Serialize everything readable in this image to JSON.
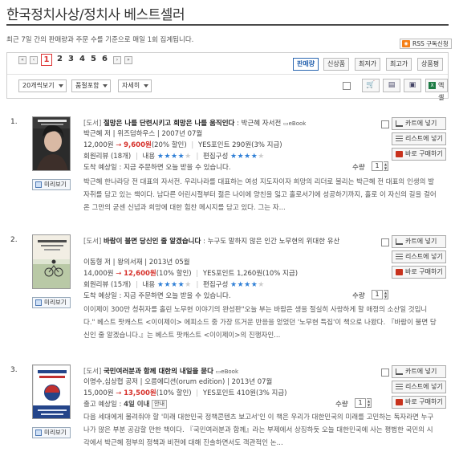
{
  "header": {
    "title": "한국정치사상/정치사 베스트셀러",
    "subtitle": "최근 7일 간의 판매량과 주문 수를 기준으로 매일 1회 집계됩니다.",
    "rss_label": "RSS 구독신청"
  },
  "toolbar": {
    "pager": {
      "first": "«",
      "prev": "‹",
      "next": "›",
      "last": "»",
      "pages": [
        "1",
        "2",
        "3",
        "4",
        "5",
        "6"
      ],
      "current": "1"
    },
    "sort_tabs": [
      "판매량",
      "신상품",
      "최저가",
      "최고가",
      "상품평"
    ],
    "active_sort": "판매량",
    "view_count": "20개씩보기",
    "filter": "품절포함",
    "detail": "자세히",
    "excel_label": "엑셀"
  },
  "books": [
    {
      "rank": "1.",
      "category": "[도서]",
      "title": "절망은 나를 단련시키고 희망은 나를 움직인다",
      "subtitle": ": 박근혜 자서전",
      "ebook": "eBook",
      "meta": "박근혜 저 | 위즈덤하우스 | 2007년 07월",
      "price_original": "12,000원",
      "price_sale": "9,600원",
      "discount": "(20% 할인)",
      "points": "YES포인트 290원(3% 지급)",
      "reviews": "회원리뷰 (18개)",
      "content_label": "내용",
      "content_stars": 4,
      "compose_label": "편집구성",
      "compose_stars": 4,
      "delivery": "도착 예상일 : 지금 주문하면 오늘 받을 수 있습니다.",
      "description": "박근혜 한나라당 전 대표의 자서전. 우리나라를 대표하는 여성 지도자이자 희망의 리더로 불리는 박근혜 전 대표의 인생의 발자취를 담고 있는 책이다. 남다른 어린시절부터 젊은 나이에 양친을 잃고 홀로서기에 성공하기까지, 홀로 이 자신의 길을 걸어온 그만의 굳센 신념과 희망에 대한 힘찬 메시지를 담고 있다. 그는 자..."
    },
    {
      "rank": "2.",
      "category": "[도서]",
      "title": "바람이 불면 당신인 줄 알겠습니다",
      "subtitle": ": 누구도 말하지 않은 인간 노무현의 위대한 유산",
      "ebook": "eBook",
      "meta": "이동형 저 | 왕의서재 | 2013년 05월",
      "price_original": "14,000원",
      "price_sale": "12,600원",
      "discount": "(10% 할인)",
      "points": "YES포인트 1,260원(10% 지급)",
      "reviews": "회원리뷰 (15개)",
      "content_label": "내용",
      "content_stars": 4,
      "compose_label": "편집구성",
      "compose_stars": 4,
      "delivery": "도착 예상일 : 지금 주문하면 오늘 받을 수 있습니다.",
      "description": "이이제이 300만 청취자를 홀린 노무현 이야기의 완성판\"오늘 부는 바람은 생을 절실히 사랑하게 할 애정의 소산일 것입니다.\" 베스트 팟캐스트 <이이제이> 에피소드 중 가장 뜨거운 반응을 얻었던 '노무현 특집'이 책으로 나왔다. 『바람이 불면 당신인 줄 알겠습니다.』는 베스트 팟캐스트 <이이제이>의 진행자인..."
    },
    {
      "rank": "3.",
      "category": "[도서]",
      "title": "국민여러분과 함께 대한의 내일을 묻다",
      "subtitle": "",
      "ebook": "eBook",
      "meta": "이명수,심상협 공저 | 오름에디션(orum edition) | 2013년 07월",
      "price_original": "15,000원",
      "price_sale": "13,500원",
      "discount": "(10% 할인)",
      "points": "YES포인트 410원(3% 지급)",
      "delivery_prefix": "출고 예상일 : ",
      "delivery_strong": "4일 이내",
      "delivery_tag": "안내",
      "description": "다음 세대에게 물려줘야 할 '미래 대한민국 정책콘텐츠 보고서'인 이 책은 우리가 대한민국의 미래를 고민하는 독자라면 누구나가 많은 부분 공감할 만한 책이다. 『국민여러분과 함께』라는 부제에서 상징하듯 오늘 대한민국에 사는 평범한 국민의 시각에서 박근혜 정부의 정책과 비전에 대해 진솔하면서도 객관적인 논..."
    }
  ],
  "row_controls": {
    "qty_label": "수량",
    "qty_value": "1",
    "cart": "카트에 넣기",
    "list": "리스트에 넣기",
    "buy": "바로 구매하기",
    "preview": "미리보기"
  }
}
